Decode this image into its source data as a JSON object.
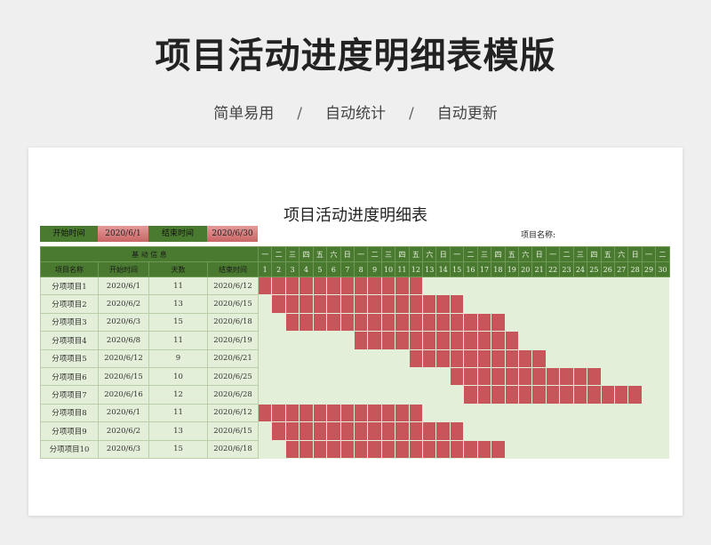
{
  "header": {
    "title": "项目活动进度明细表模版",
    "tags": [
      "简单易用",
      "自动统计",
      "自动更新"
    ],
    "separator": "/"
  },
  "sheet": {
    "title": "项目活动进度明细表",
    "start_label": "开始时间",
    "start_date": "2020/6/1",
    "end_label": "结束时间",
    "end_date": "2020/6/30",
    "project_name_label": "项目名称:"
  },
  "table": {
    "group_header": "基  动  信  息",
    "columns": [
      "项目名称",
      "开始时间",
      "天数",
      "结束时间"
    ],
    "weekdays": [
      "一",
      "二",
      "三",
      "四",
      "五",
      "六",
      "日",
      "一",
      "二",
      "三",
      "四",
      "五",
      "六",
      "日",
      "一",
      "二",
      "三",
      "四",
      "五",
      "六",
      "日",
      "一",
      "二",
      "三",
      "四",
      "五",
      "六",
      "日",
      "一",
      "二"
    ],
    "days": [
      "1",
      "2",
      "3",
      "4",
      "5",
      "6",
      "7",
      "8",
      "9",
      "10",
      "11",
      "12",
      "13",
      "14",
      "15",
      "16",
      "17",
      "18",
      "19",
      "20",
      "21",
      "22",
      "23",
      "24",
      "25",
      "26",
      "27",
      "28",
      "29",
      "30"
    ],
    "rows": [
      {
        "name": "分项项目1",
        "start": "2020/6/1",
        "days": "11",
        "end": "2020/6/12",
        "bar_start_day": 1,
        "bar_days": 12
      },
      {
        "name": "分项项目2",
        "start": "2020/6/2",
        "days": "13",
        "end": "2020/6/15",
        "bar_start_day": 2,
        "bar_days": 14
      },
      {
        "name": "分项项目3",
        "start": "2020/6/3",
        "days": "15",
        "end": "2020/6/18",
        "bar_start_day": 3,
        "bar_days": 16
      },
      {
        "name": "分项项目4",
        "start": "2020/6/8",
        "days": "11",
        "end": "2020/6/19",
        "bar_start_day": 8,
        "bar_days": 12
      },
      {
        "name": "分项项目5",
        "start": "2020/6/12",
        "days": "9",
        "end": "2020/6/21",
        "bar_start_day": 12,
        "bar_days": 10
      },
      {
        "name": "分项项目6",
        "start": "2020/6/15",
        "days": "10",
        "end": "2020/6/25",
        "bar_start_day": 15,
        "bar_days": 11
      },
      {
        "name": "分项项目7",
        "start": "2020/6/16",
        "days": "12",
        "end": "2020/6/28",
        "bar_start_day": 16,
        "bar_days": 13
      },
      {
        "name": "分项项目8",
        "start": "2020/6/1",
        "days": "11",
        "end": "2020/6/12",
        "bar_start_day": 1,
        "bar_days": 12
      },
      {
        "name": "分项项目9",
        "start": "2020/6/2",
        "days": "13",
        "end": "2020/6/15",
        "bar_start_day": 2,
        "bar_days": 14
      },
      {
        "name": "分项项目10",
        "start": "2020/6/3",
        "days": "15",
        "end": "2020/6/18",
        "bar_start_day": 3,
        "bar_days": 16
      }
    ]
  },
  "colors": {
    "header_green": "#4a7a30",
    "row_green": "#e4efd9",
    "bar_red": "#c8555a",
    "date_pink": "#d97878"
  }
}
